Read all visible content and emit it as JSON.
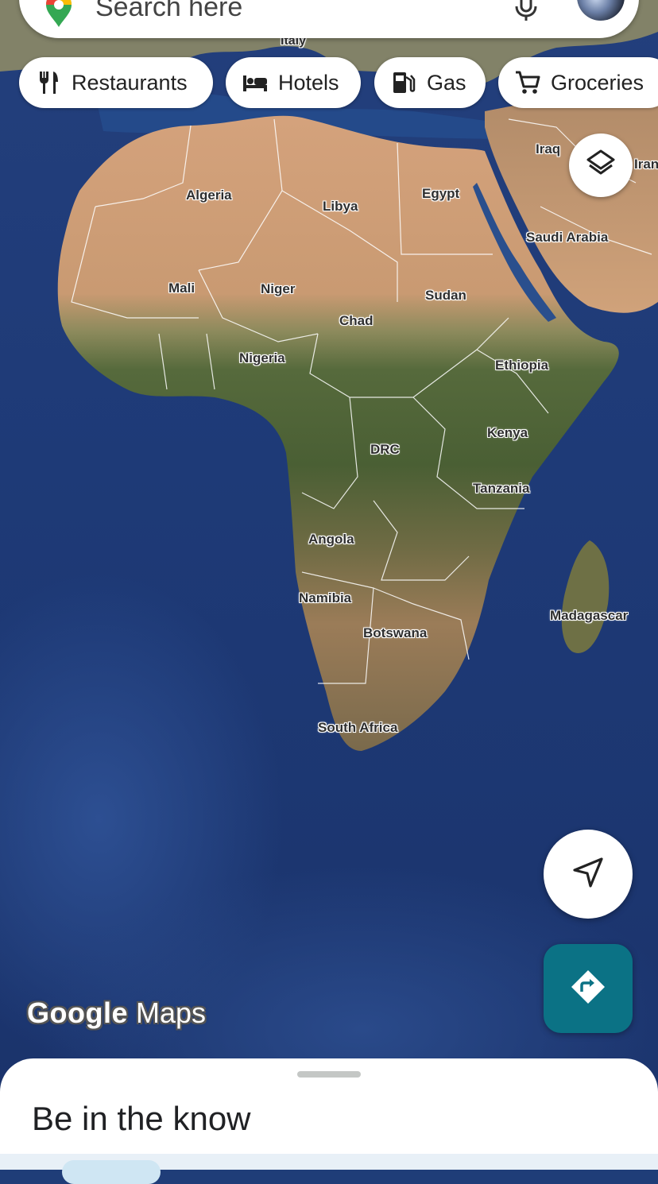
{
  "search": {
    "placeholder": "Search here"
  },
  "chips": [
    {
      "label": "Restaurants",
      "icon": "fork-knife-icon"
    },
    {
      "label": "Hotels",
      "icon": "bed-icon"
    },
    {
      "label": "Gas",
      "icon": "gas-pump-icon"
    },
    {
      "label": "Groceries",
      "icon": "cart-icon"
    }
  ],
  "map": {
    "labels": {
      "italy": "Italy",
      "algeria": "Algeria",
      "libya": "Libya",
      "egypt": "Egypt",
      "iraq": "Iraq",
      "iran": "Iran",
      "saudi_arabia": "Saudi Arabia",
      "mali": "Mali",
      "niger": "Niger",
      "sudan": "Sudan",
      "chad": "Chad",
      "nigeria": "Nigeria",
      "ethiopia": "Ethiopia",
      "kenya": "Kenya",
      "drc": "DRC",
      "tanzania": "Tanzania",
      "angola": "Angola",
      "namibia": "Namibia",
      "botswana": "Botswana",
      "madagascar": "Madagascar",
      "south_africa": "South Africa"
    },
    "logo": {
      "google": "Google",
      "maps": "Maps"
    }
  },
  "bottom_sheet": {
    "title": "Be in the know"
  },
  "colors": {
    "directions_button": "#0b7285",
    "ocean": "#1e3a77"
  }
}
